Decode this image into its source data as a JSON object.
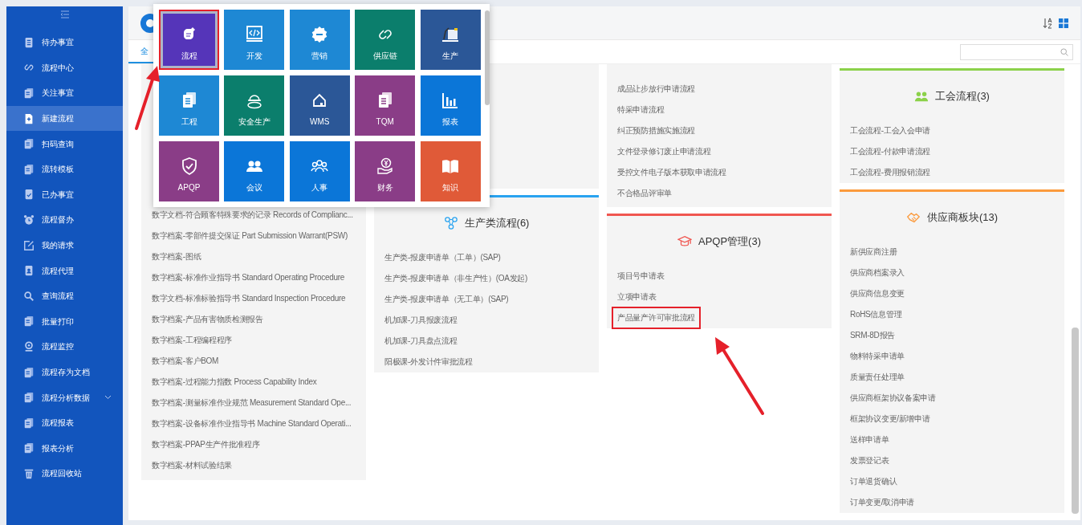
{
  "sidebar": {
    "items": [
      {
        "label": "待办事宜",
        "selected": false,
        "kind": "link"
      },
      {
        "label": "流程中心",
        "selected": false,
        "kind": "link"
      },
      {
        "label": "关注事宜",
        "selected": false,
        "kind": "link"
      },
      {
        "label": "新建流程",
        "selected": true,
        "kind": "link"
      },
      {
        "label": "扫码查询",
        "selected": false,
        "kind": "link"
      },
      {
        "label": "流转模板",
        "selected": false,
        "kind": "link"
      },
      {
        "label": "已办事宜",
        "selected": false,
        "kind": "link"
      },
      {
        "label": "流程督办",
        "selected": false,
        "kind": "link"
      },
      {
        "label": "我的请求",
        "selected": false,
        "kind": "link"
      },
      {
        "label": "流程代理",
        "selected": false,
        "kind": "link"
      },
      {
        "label": "查询流程",
        "selected": false,
        "kind": "link"
      },
      {
        "label": "批量打印",
        "selected": false,
        "kind": "link"
      },
      {
        "label": "流程监控",
        "selected": false,
        "kind": "link"
      },
      {
        "label": "流程存为文档",
        "selected": false,
        "kind": "link"
      },
      {
        "label": "流程分析数据",
        "selected": false,
        "kind": "submenu"
      },
      {
        "label": "流程报表",
        "selected": false,
        "kind": "link"
      },
      {
        "label": "报表分析",
        "selected": false,
        "kind": "link"
      },
      {
        "label": "流程回收站",
        "selected": false,
        "kind": "link"
      }
    ]
  },
  "tabs": [
    {
      "label": "全",
      "selected": true
    }
  ],
  "tiles": [
    {
      "label": "流程",
      "color": "#5535b9",
      "selected": true,
      "highlighted": true
    },
    {
      "label": "开发",
      "color": "#1e88d4",
      "selected": false,
      "highlighted": false
    },
    {
      "label": "营销",
      "color": "#1e88d4",
      "selected": false,
      "highlighted": false
    },
    {
      "label": "供应链",
      "color": "#0b7e6c",
      "selected": false,
      "highlighted": false
    },
    {
      "label": "生产",
      "color": "#2b5797",
      "selected": false,
      "highlighted": false
    },
    {
      "label": "工程",
      "color": "#1e88d4",
      "selected": false,
      "highlighted": false
    },
    {
      "label": "安全生产",
      "color": "#0b7e6c",
      "selected": false,
      "highlighted": false
    },
    {
      "label": "WMS",
      "color": "#2b5797",
      "selected": false,
      "highlighted": false
    },
    {
      "label": "TQM",
      "color": "#8a3d87",
      "selected": false,
      "highlighted": false
    },
    {
      "label": "报表",
      "color": "#0b76d8",
      "selected": false,
      "highlighted": false
    },
    {
      "label": "APQP",
      "color": "#8a3d87",
      "selected": false,
      "highlighted": false
    },
    {
      "label": "会议",
      "color": "#0b76d8",
      "selected": false,
      "highlighted": false
    },
    {
      "label": "人事",
      "color": "#0b76d8",
      "selected": false,
      "highlighted": false
    },
    {
      "label": "财务",
      "color": "#8a3d87",
      "selected": false,
      "highlighted": false
    },
    {
      "label": "知识",
      "color": "#e05a38",
      "selected": false,
      "highlighted": false
    }
  ],
  "columns": [
    {
      "sections": [
        {
          "kind": "continued",
          "items": [
            {
              "label": "数字文档-符合顾客特殊要求的记录 Records of Complianc...",
              "highlighted": false
            },
            {
              "label": "数字档案-零部件提交保证 Part Submission Warrant(PSW)",
              "highlighted": false
            },
            {
              "label": "数字档案-图纸",
              "highlighted": false
            },
            {
              "label": "数字档案-标准作业指导书 Standard Operating Procedure",
              "highlighted": false
            },
            {
              "label": "数字文档-标准标验指导书 Standard Inspection Procedure",
              "highlighted": false
            },
            {
              "label": "数字档案-产品有害物质检测报告",
              "highlighted": false
            },
            {
              "label": "数字档案-工程编程程序",
              "highlighted": false
            },
            {
              "label": "数字档案-客户BOM",
              "highlighted": false
            },
            {
              "label": "数字档案-过程能力指数 Process Capability Index",
              "highlighted": false
            },
            {
              "label": "数字档案-测量标准作业规范 Measurement Standard Ope...",
              "highlighted": false
            },
            {
              "label": "数字档案-设备标准作业指导书 Machine Standard Operati...",
              "highlighted": false
            },
            {
              "label": "数字档案-PPAP生产件批准程序",
              "highlighted": false
            },
            {
              "label": "数字档案-材料试验结果",
              "highlighted": false
            }
          ]
        }
      ]
    },
    {
      "sections": [
        {
          "kind": "covered"
        },
        {
          "kind": "list",
          "title": "生产类流程(6)",
          "color": "#29a3f0",
          "items": [
            {
              "label": "生产类-报废申请单（工单）(SAP)",
              "highlighted": false
            },
            {
              "label": "生产类-报废申请单（非生产性）(OA发起)",
              "highlighted": false
            },
            {
              "label": "生产类-报废申请单（无工单）(SAP)",
              "highlighted": false
            },
            {
              "label": "机加课-刀具报废流程",
              "highlighted": false
            },
            {
              "label": "机加课-刀具盘点流程",
              "highlighted": false
            },
            {
              "label": "阳极课-外发计件审批流程",
              "highlighted": false
            }
          ]
        }
      ]
    },
    {
      "sections": [
        {
          "kind": "continued",
          "items": [
            {
              "label": "成品让步放行申请流程",
              "highlighted": false
            },
            {
              "label": "特采申请流程",
              "highlighted": false
            },
            {
              "label": "纠正预防措施实施流程",
              "highlighted": false
            },
            {
              "label": "文件登录修订废止申请流程",
              "highlighted": false
            },
            {
              "label": "受控文件电子版本获取申请流程",
              "highlighted": false
            },
            {
              "label": "不合格品评审单",
              "highlighted": false
            }
          ]
        },
        {
          "kind": "list",
          "title": "APQP管理(3)",
          "color": "#f05650",
          "items": [
            {
              "label": "项目号申请表",
              "highlighted": false
            },
            {
              "label": "立项申请表",
              "highlighted": false
            },
            {
              "label": "产品量产许可审批流程",
              "highlighted": true
            }
          ]
        }
      ]
    },
    {
      "sections": [
        {
          "kind": "list",
          "title": "工会流程(3)",
          "color": "#8bd14a",
          "items": [
            {
              "label": "工会流程-工会入会申请",
              "highlighted": false
            },
            {
              "label": "工会流程-付款申请流程",
              "highlighted": false
            },
            {
              "label": "工会流程-费用报销流程",
              "highlighted": false
            }
          ]
        },
        {
          "kind": "list",
          "title": "供应商板块(13)",
          "color": "#fb9a3c",
          "items": [
            {
              "label": "新供应商注册",
              "highlighted": false
            },
            {
              "label": "供应商档案录入",
              "highlighted": false
            },
            {
              "label": "供应商信息变更",
              "highlighted": false
            },
            {
              "label": "RoHS信息管理",
              "highlighted": false
            },
            {
              "label": "SRM-8D报告",
              "highlighted": false
            },
            {
              "label": "物料特采申请单",
              "highlighted": false
            },
            {
              "label": "质量责任处理单",
              "highlighted": false
            },
            {
              "label": "供应商框架协议备案申请",
              "highlighted": false
            },
            {
              "label": "框架协议变更/新增申请",
              "highlighted": false
            },
            {
              "label": "送样申请单",
              "highlighted": false
            },
            {
              "label": "发票登记表",
              "highlighted": false
            },
            {
              "label": "订单退货确认",
              "highlighted": false
            },
            {
              "label": "订单变更/取消申请",
              "highlighted": false
            }
          ]
        }
      ]
    }
  ]
}
